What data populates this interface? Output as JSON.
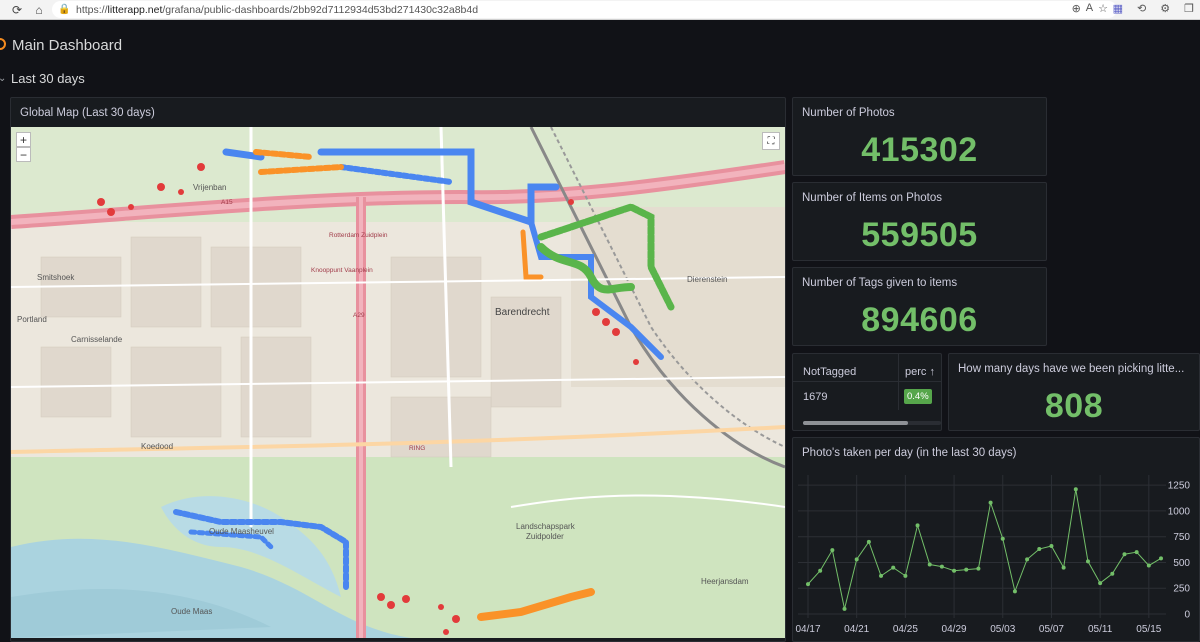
{
  "browser": {
    "url_prefix": "https://",
    "url_host": "litterapp.net",
    "url_path": "/grafana/public-dashboards/2bb92d7112934d53bd271430c32a8b4d"
  },
  "dashboard": {
    "title": "Main Dashboard",
    "row_title": "Last 30 days"
  },
  "map_panel": {
    "title": "Global Map (Last 30 days)",
    "zoom_in": "+",
    "zoom_out": "−",
    "labels": {
      "barendrecht": "Barendrecht",
      "smitshoek": "Smitshoek",
      "portland": "Portland",
      "carnisselande": "Carnisselande",
      "dierenstein": "Dierenstein",
      "heerjansdam": "Heerjansdam",
      "koedood": "Koedood",
      "oude_maas": "Oude Maas",
      "oude_maasheuvel": "Oude Maasheuvel",
      "landschapspark": "Landschapspark",
      "zuidpolder": "Zuidpolder",
      "vrijenban": "Vrijenban",
      "ring": "RING",
      "a15": "A15",
      "a29": "A29",
      "rotterdamzuid": "Rotterdam Zuidplein",
      "knooppunt": "Knooppunt Vaanplein"
    }
  },
  "stats": [
    {
      "title": "Number of Photos",
      "value": "415302"
    },
    {
      "title": "Number of Items on Photos",
      "value": "559505"
    },
    {
      "title": "Number of Tags given to items",
      "value": "894606"
    }
  ],
  "table_panel": {
    "col1": "NotTagged",
    "col2": "perc ↑",
    "row_value": "1679",
    "row_perc": "0.4%"
  },
  "days_panel": {
    "title": "How many days have we been picking litte...",
    "value": "808"
  },
  "chart_panel": {
    "title": "Photo's taken per day (in the last 30 days)"
  },
  "chart_data": {
    "type": "line",
    "title": "Photo's taken per day (in the last 30 days)",
    "x_tick_labels": [
      "04/17",
      "04/21",
      "04/25",
      "04/29",
      "05/03",
      "05/07",
      "05/11",
      "05/15"
    ],
    "y_ticks": [
      0,
      250,
      500,
      750,
      1000,
      1250
    ],
    "ylim": [
      0,
      1300
    ],
    "color": "#73bf69",
    "values": [
      290,
      420,
      620,
      50,
      530,
      700,
      370,
      450,
      370,
      860,
      480,
      460,
      420,
      430,
      440,
      1080,
      730,
      220,
      530,
      630,
      660,
      450,
      1210,
      510,
      300,
      390,
      580,
      600,
      470,
      540
    ],
    "grid": true
  }
}
